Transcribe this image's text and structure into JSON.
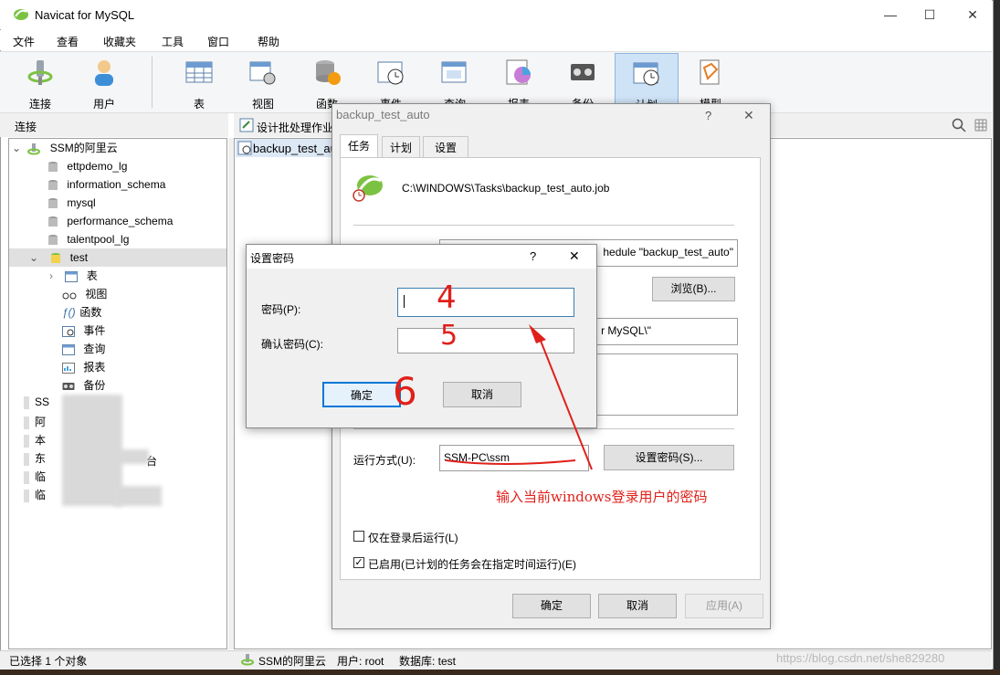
{
  "window": {
    "title": "Navicat for MySQL",
    "minimize": "—",
    "maximize": "☐",
    "close": "✕"
  },
  "menu": [
    "文件",
    "查看",
    "收藏夹",
    "工具",
    "窗口",
    "帮助"
  ],
  "toolbar": {
    "connect": "连接",
    "user": "用户",
    "table": "表",
    "view": "视图",
    "function": "函数",
    "event": "事件",
    "query": "查询",
    "report": "报表",
    "backup": "备份",
    "schedule": "计划",
    "model": "模型"
  },
  "left_panel": {
    "header": "连接"
  },
  "tree": {
    "root": "SSM的阿里云",
    "dbs": [
      "ettpdemo_lg",
      "information_schema",
      "mysql",
      "performance_schema",
      "talentpool_lg"
    ],
    "selected_db": "test",
    "children": [
      "表",
      "视图",
      "函数",
      "事件",
      "查询",
      "报表",
      "备份"
    ],
    "other_conns": [
      "SS",
      "阿",
      "本",
      "东",
      "台",
      "临",
      "临"
    ]
  },
  "right_panel": {
    "header": "设计批处理作业",
    "item": "backup_test_auto"
  },
  "statusbar": {
    "selection": "已选择 1 个对象",
    "connection": "SSM的阿里云",
    "user": "用户: root",
    "database": "数据库: test"
  },
  "watermark": "https://blog.csdn.net/she829280",
  "backup_dialog": {
    "title": "backup_test_auto",
    "help": "?",
    "close": "✕",
    "tabs": [
      "任务",
      "计划",
      "设置"
    ],
    "task_path": "C:\\WINDOWS\\Tasks\\backup_test_auto.job",
    "run_field": "hedule \"backup_test_auto\"",
    "browse": "浏览(B)...",
    "start_in": "r MySQL\\\"",
    "run_as_label": "运行方式(U):",
    "run_as_value": "SSM-PC\\ssm",
    "set_password": "设置密码(S)...",
    "only_logged_on": "仅在登录后运行(L)",
    "enabled": "已启用(已计划的任务会在指定时间运行)(E)",
    "ok": "确定",
    "cancel": "取消",
    "apply": "应用(A)"
  },
  "password_dialog": {
    "title": "设置密码",
    "help": "?",
    "close": "✕",
    "password_label": "密码(P):",
    "confirm_label": "确认密码(C):",
    "ok": "确定",
    "cancel": "取消"
  },
  "annotations": {
    "a4": "4",
    "a5": "5",
    "a6": "6",
    "note": "输入当前windows登录用户的密码"
  }
}
